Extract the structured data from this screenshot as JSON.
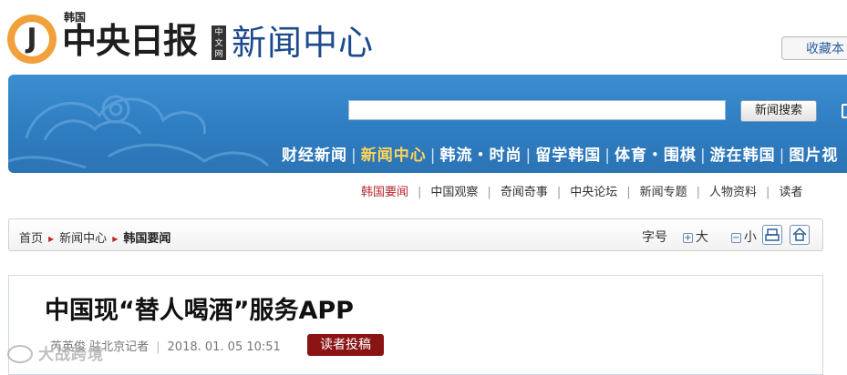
{
  "header": {
    "logo_letter": "J",
    "logo_country": "韩国",
    "logo_name": "中央日报",
    "logo_tag": "中文网",
    "section_title": "新闻中心",
    "favorite_label": "收藏本"
  },
  "search": {
    "value": "",
    "button_label": "新闻搜索"
  },
  "main_nav": {
    "items": [
      {
        "label": "财经新闻"
      },
      {
        "label": "新闻中心"
      },
      {
        "label": "韩流・时尚"
      },
      {
        "label": "留学韩国"
      },
      {
        "label": "体育・围棋"
      },
      {
        "label": "游在韩国"
      },
      {
        "label": "图片视"
      }
    ],
    "active_index": 1,
    "separator": "|"
  },
  "sub_nav": {
    "items": [
      {
        "label": "韩国要闻"
      },
      {
        "label": "中国观察"
      },
      {
        "label": "奇闻奇事"
      },
      {
        "label": "中央论坛"
      },
      {
        "label": "新闻专题"
      },
      {
        "label": "人物资料"
      },
      {
        "label": "读者"
      }
    ],
    "active_index": 0,
    "separator": "|"
  },
  "breadcrumb": {
    "items": [
      "首页",
      "新闻中心",
      "韩国要闻"
    ]
  },
  "font_tools": {
    "label": "字号",
    "larger": "大",
    "smaller": "小",
    "plus": "+",
    "minus": "−"
  },
  "article": {
    "title": "中国现“替人喝酒”服务APP",
    "byline": "芮英俊  驻北京记者",
    "date": "2018. 01. 05  10:51",
    "reader_button": "读者投稿"
  },
  "watermark": {
    "text": "大战跨境"
  },
  "colors": {
    "banner_blue": "#2f7dc1",
    "active_nav": "#ffd45a",
    "accent_red": "#b5272d",
    "reader_button": "#8a1414",
    "section_title": "#1c4a8c"
  }
}
